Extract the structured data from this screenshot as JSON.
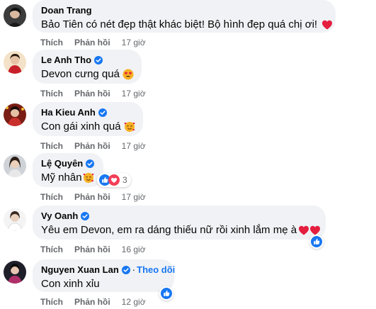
{
  "comments": [
    {
      "name": "Doan Trang",
      "verified": false,
      "text": "Bảo Tiên có nét đẹp thật khác biệt! Bộ hình đẹp quá chị ơi!",
      "emoji": "red-heart",
      "like": "Thích",
      "reply": "Phản hồi",
      "time": "17 giờ"
    },
    {
      "name": "Le Anh Tho",
      "verified": true,
      "text": "Devon cưng quá",
      "emoji": "heart-eyes",
      "like": "Thích",
      "reply": "Phản hồi",
      "time": "17 giờ"
    },
    {
      "name": "Ha Kieu Anh",
      "verified": true,
      "text": "Con gái xinh quá",
      "emoji": "smiling-face-with-hearts",
      "like": "Thích",
      "reply": "Phản hồi",
      "time": "17 giờ"
    },
    {
      "name": "Lệ Quyên",
      "verified": true,
      "text": "Mỹ nhân",
      "emoji": "smiling-face-with-hearts",
      "reaction_count": "3",
      "reactions": [
        "like",
        "love"
      ],
      "like": "Thích",
      "reply": "Phản hồi",
      "time": "17 giờ"
    },
    {
      "name": "Vy Oanh",
      "verified": true,
      "text": "Yêu em Devon, em ra dáng thiếu nữ rồi xinh lắm mẹ à",
      "emoji": "two-red-hearts",
      "reactions": [
        "like"
      ],
      "like": "Thích",
      "reply": "Phản hồi",
      "time": "16 giờ"
    },
    {
      "name": "Nguyen Xuan Lan",
      "verified": true,
      "follow": "Theo dõi",
      "separator": "·",
      "text": "Con xinh xỉu",
      "reactions": [
        "like"
      ],
      "like": "Thích",
      "reply": "Phản hồi",
      "time": "12 giờ"
    }
  ],
  "colors": {
    "bubble": "#f0f2f5",
    "meta_text": "#65676b",
    "link_blue": "#1877f2",
    "heart_red": "#e41e3f"
  }
}
